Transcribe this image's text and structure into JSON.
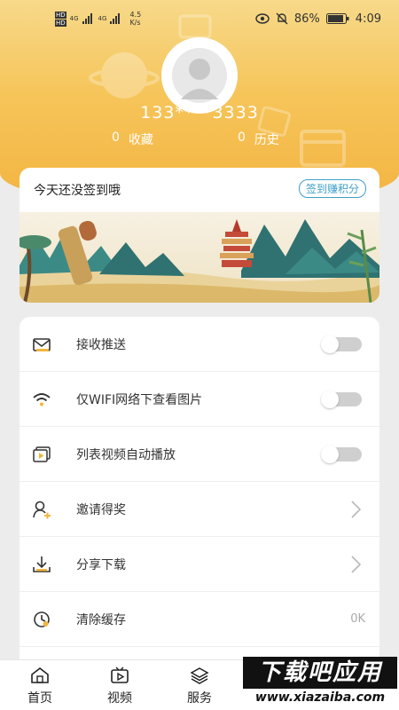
{
  "status_bar": {
    "net_speed": "4.5",
    "net_unit": "K/s",
    "signal_1": "4G",
    "signal_2": "4G",
    "hd_1": "HD",
    "hd_2": "HD",
    "battery": "86%",
    "time": "4:09"
  },
  "profile": {
    "phone": "133****3333",
    "favorites_count": "0",
    "favorites_label": "收藏",
    "history_count": "0",
    "history_label": "历史"
  },
  "signin": {
    "title": "今天还没签到哦",
    "button": "签到赚积分"
  },
  "settings": {
    "items": [
      {
        "label": "接收推送",
        "control": "toggle",
        "on": false,
        "icon": "mail-icon"
      },
      {
        "label": "仅WIFI网络下查看图片",
        "control": "toggle",
        "on": false,
        "icon": "wifi-icon"
      },
      {
        "label": "列表视频自动播放",
        "control": "toggle",
        "on": false,
        "icon": "video-play-icon"
      },
      {
        "label": "邀请得奖",
        "control": "chevron",
        "icon": "invite-user-icon"
      },
      {
        "label": "分享下载",
        "control": "chevron",
        "icon": "download-icon"
      },
      {
        "label": "清除缓存",
        "control": "value",
        "value": "0K",
        "icon": "clear-cache-icon"
      }
    ]
  },
  "bottom_nav": {
    "items": [
      {
        "label": "首页",
        "icon": "home-icon"
      },
      {
        "label": "视频",
        "icon": "video-icon"
      },
      {
        "label": "服务",
        "icon": "layers-icon"
      }
    ]
  },
  "watermark": {
    "title": "下载吧应用",
    "url": "www.xiazaiba.com"
  },
  "colors": {
    "header_top": "#f7d98a",
    "header_bottom": "#f3b340",
    "accent_blue": "#3fa0c8",
    "toggle_off": "#cfcfcf"
  }
}
